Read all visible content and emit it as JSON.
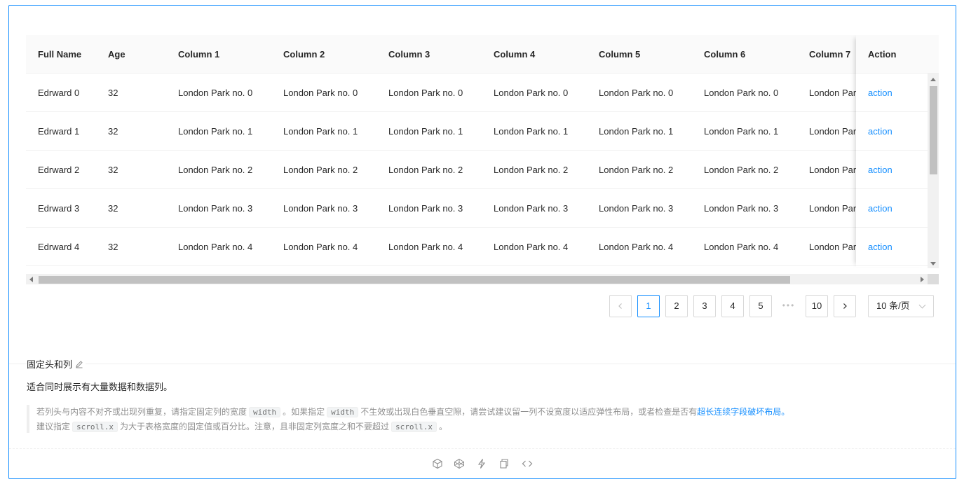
{
  "table": {
    "columns": [
      "Full Name",
      "Age",
      "Column 1",
      "Column 2",
      "Column 3",
      "Column 4",
      "Column 5",
      "Column 6",
      "Column 7",
      "Action"
    ],
    "rows": [
      {
        "name": "Edrward 0",
        "age": "32",
        "address": "London Park no. 0",
        "address_clipped": "London Par",
        "action": "action"
      },
      {
        "name": "Edrward 1",
        "age": "32",
        "address": "London Park no. 1",
        "address_clipped": "London Par",
        "action": "action"
      },
      {
        "name": "Edrward 2",
        "age": "32",
        "address": "London Park no. 2",
        "address_clipped": "London Par",
        "action": "action"
      },
      {
        "name": "Edrward 3",
        "age": "32",
        "address": "London Park no. 3",
        "address_clipped": "London Par",
        "action": "action"
      },
      {
        "name": "Edrward 4",
        "age": "32",
        "address": "London Park no. 4",
        "address_clipped": "London Par",
        "action": "action"
      }
    ]
  },
  "pagination": {
    "pages": [
      "1",
      "2",
      "3",
      "4",
      "5",
      "10"
    ],
    "current": "1",
    "ellipsis": "•••",
    "page_size": "10 条/页"
  },
  "demo": {
    "title": "固定头和列",
    "description": "适合同时展示有大量数据和数据列。",
    "note_line1_a": "若列头与内容不对齐或出现列重复，请指定固定列的宽度",
    "note_code1": "width",
    "note_line1_b": "。如果指定",
    "note_code2": "width",
    "note_line1_c": "不生效或出现白色垂直空隙，请尝试建议留一列不设宽度以适应弹性布局，或者检查是否有",
    "note_link": "超长连续字段破坏布局。",
    "note_line2_a": "建议指定",
    "note_code3": "scroll.x",
    "note_line2_b": "为大于表格宽度的固定值或百分比。注意，且非固定列宽度之和不要超过",
    "note_code4": "scroll.x",
    "note_line2_c": "。"
  },
  "toolbar_icons": [
    "codesandbox-icon",
    "codepen-icon",
    "thunderbolt-icon",
    "copy-icon",
    "code-icon"
  ],
  "colors": {
    "primary": "#1890ff",
    "border": "#d9d9d9",
    "header_bg": "#fafafa"
  }
}
